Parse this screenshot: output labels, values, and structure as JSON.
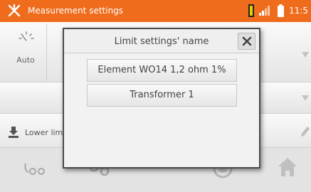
{
  "header": {
    "title": "Measurement settings",
    "time": "11:5"
  },
  "background": {
    "auto_label": "Auto",
    "lower_label": "Lower lim"
  },
  "dialog": {
    "title": "Limit settings' name",
    "items": [
      {
        "label": "Element WO14 1,2 ohm 1%"
      },
      {
        "label": "Transformer 1"
      }
    ]
  },
  "colors": {
    "header_bg": "#ef6c1d",
    "icon_orange": "#ef6c1d"
  }
}
